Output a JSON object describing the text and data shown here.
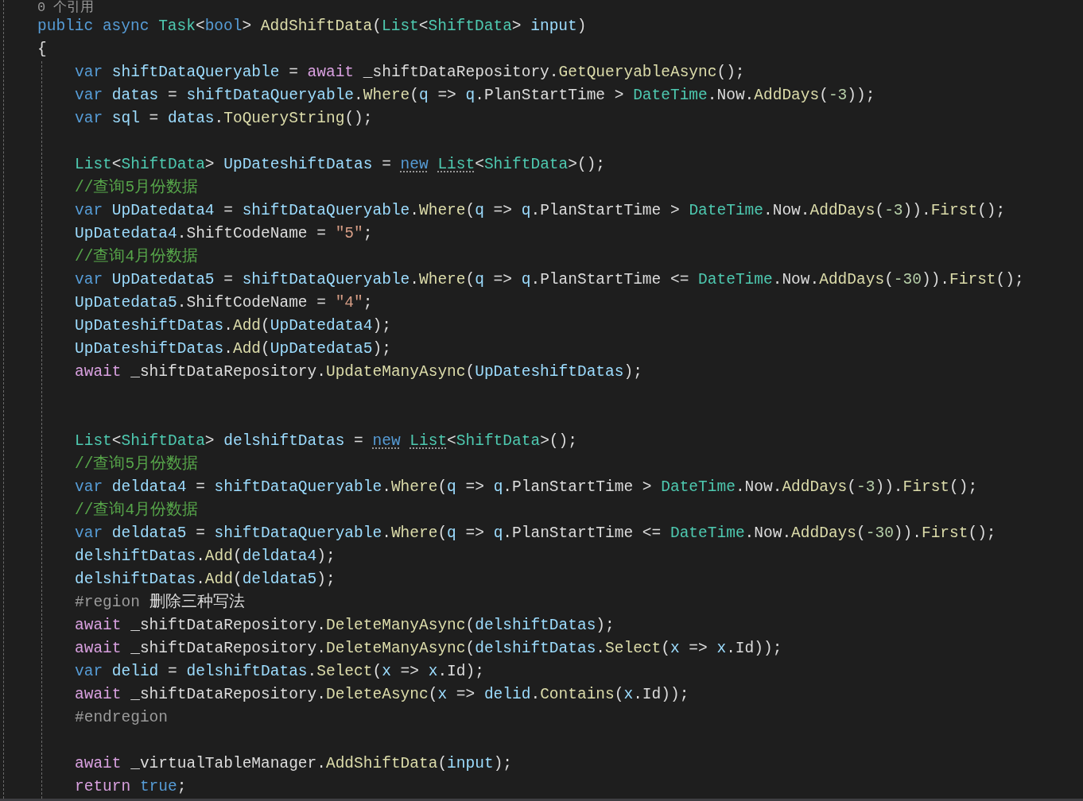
{
  "codelens": "0 个引用",
  "method": {
    "signature": [
      {
        "kind": "k",
        "text": "public async "
      },
      {
        "kind": "t",
        "text": "Task"
      },
      {
        "kind": "p",
        "text": "<"
      },
      {
        "kind": "k",
        "text": "bool"
      },
      {
        "kind": "p",
        "text": "> "
      },
      {
        "kind": "m",
        "text": "AddShiftData"
      },
      {
        "kind": "p",
        "text": "("
      },
      {
        "kind": "t",
        "text": "List"
      },
      {
        "kind": "p",
        "text": "<"
      },
      {
        "kind": "t",
        "text": "ShiftData"
      },
      {
        "kind": "p",
        "text": "> "
      },
      {
        "kind": "v",
        "text": "input"
      },
      {
        "kind": "p",
        "text": ")"
      }
    ],
    "open_brace": "{",
    "body": [
      {
        "kind": "code",
        "tokens": [
          {
            "kind": "k",
            "text": "var "
          },
          {
            "kind": "v",
            "text": "shiftDataQueryable"
          },
          {
            "kind": "p",
            "text": " = "
          },
          {
            "kind": "c",
            "text": "await"
          },
          {
            "kind": "p",
            "text": " _shiftDataRepository."
          },
          {
            "kind": "m",
            "text": "GetQueryableAsync"
          },
          {
            "kind": "p",
            "text": "();"
          }
        ]
      },
      {
        "kind": "code",
        "tokens": [
          {
            "kind": "k",
            "text": "var "
          },
          {
            "kind": "v",
            "text": "datas"
          },
          {
            "kind": "p",
            "text": " = "
          },
          {
            "kind": "v",
            "text": "shiftDataQueryable"
          },
          {
            "kind": "p",
            "text": "."
          },
          {
            "kind": "m",
            "text": "Where"
          },
          {
            "kind": "p",
            "text": "("
          },
          {
            "kind": "v",
            "text": "q"
          },
          {
            "kind": "p",
            "text": " => "
          },
          {
            "kind": "v",
            "text": "q"
          },
          {
            "kind": "p",
            "text": ".PlanStartTime > "
          },
          {
            "kind": "t",
            "text": "DateTime"
          },
          {
            "kind": "p",
            "text": ".Now."
          },
          {
            "kind": "m",
            "text": "AddDays"
          },
          {
            "kind": "p",
            "text": "("
          },
          {
            "kind": "n",
            "text": "-3"
          },
          {
            "kind": "p",
            "text": "));"
          }
        ]
      },
      {
        "kind": "code",
        "tokens": [
          {
            "kind": "k",
            "text": "var "
          },
          {
            "kind": "v",
            "text": "sql"
          },
          {
            "kind": "p",
            "text": " = "
          },
          {
            "kind": "v",
            "text": "datas"
          },
          {
            "kind": "p",
            "text": "."
          },
          {
            "kind": "m",
            "text": "ToQueryString"
          },
          {
            "kind": "p",
            "text": "();"
          }
        ]
      },
      {
        "kind": "blank"
      },
      {
        "kind": "code",
        "tokens": [
          {
            "kind": "t",
            "text": "List"
          },
          {
            "kind": "p",
            "text": "<"
          },
          {
            "kind": "t",
            "text": "ShiftData"
          },
          {
            "kind": "p",
            "text": "> "
          },
          {
            "kind": "v",
            "text": "UpDateshiftDatas"
          },
          {
            "kind": "p",
            "text": " = "
          },
          {
            "kind": "kd",
            "text": "new "
          },
          {
            "kind": "td",
            "text": "List"
          },
          {
            "kind": "p",
            "text": "<"
          },
          {
            "kind": "t",
            "text": "ShiftData"
          },
          {
            "kind": "p",
            "text": ">();"
          }
        ]
      },
      {
        "kind": "code",
        "tokens": [
          {
            "kind": "cm",
            "text": "//查询5月份数据"
          }
        ]
      },
      {
        "kind": "code",
        "tokens": [
          {
            "kind": "k",
            "text": "var "
          },
          {
            "kind": "v",
            "text": "UpDatedata4"
          },
          {
            "kind": "p",
            "text": " = "
          },
          {
            "kind": "v",
            "text": "shiftDataQueryable"
          },
          {
            "kind": "p",
            "text": "."
          },
          {
            "kind": "m",
            "text": "Where"
          },
          {
            "kind": "p",
            "text": "("
          },
          {
            "kind": "v",
            "text": "q"
          },
          {
            "kind": "p",
            "text": " => "
          },
          {
            "kind": "v",
            "text": "q"
          },
          {
            "kind": "p",
            "text": ".PlanStartTime > "
          },
          {
            "kind": "t",
            "text": "DateTime"
          },
          {
            "kind": "p",
            "text": ".Now."
          },
          {
            "kind": "m",
            "text": "AddDays"
          },
          {
            "kind": "p",
            "text": "("
          },
          {
            "kind": "n",
            "text": "-3"
          },
          {
            "kind": "p",
            "text": "))."
          },
          {
            "kind": "m",
            "text": "First"
          },
          {
            "kind": "p",
            "text": "();"
          }
        ]
      },
      {
        "kind": "code",
        "tokens": [
          {
            "kind": "v",
            "text": "UpDatedata4"
          },
          {
            "kind": "p",
            "text": ".ShiftCodeName = "
          },
          {
            "kind": "s",
            "text": "\"5\""
          },
          {
            "kind": "p",
            "text": ";"
          }
        ]
      },
      {
        "kind": "code",
        "tokens": [
          {
            "kind": "cm",
            "text": "//查询4月份数据"
          }
        ]
      },
      {
        "kind": "code",
        "tokens": [
          {
            "kind": "k",
            "text": "var "
          },
          {
            "kind": "v",
            "text": "UpDatedata5"
          },
          {
            "kind": "p",
            "text": " = "
          },
          {
            "kind": "v",
            "text": "shiftDataQueryable"
          },
          {
            "kind": "p",
            "text": "."
          },
          {
            "kind": "m",
            "text": "Where"
          },
          {
            "kind": "p",
            "text": "("
          },
          {
            "kind": "v",
            "text": "q"
          },
          {
            "kind": "p",
            "text": " => "
          },
          {
            "kind": "v",
            "text": "q"
          },
          {
            "kind": "p",
            "text": ".PlanStartTime <= "
          },
          {
            "kind": "t",
            "text": "DateTime"
          },
          {
            "kind": "p",
            "text": ".Now."
          },
          {
            "kind": "m",
            "text": "AddDays"
          },
          {
            "kind": "p",
            "text": "("
          },
          {
            "kind": "n",
            "text": "-30"
          },
          {
            "kind": "p",
            "text": "))."
          },
          {
            "kind": "m",
            "text": "First"
          },
          {
            "kind": "p",
            "text": "();"
          }
        ]
      },
      {
        "kind": "code",
        "tokens": [
          {
            "kind": "v",
            "text": "UpDatedata5"
          },
          {
            "kind": "p",
            "text": ".ShiftCodeName = "
          },
          {
            "kind": "s",
            "text": "\"4\""
          },
          {
            "kind": "p",
            "text": ";"
          }
        ]
      },
      {
        "kind": "code",
        "tokens": [
          {
            "kind": "v",
            "text": "UpDateshiftDatas"
          },
          {
            "kind": "p",
            "text": "."
          },
          {
            "kind": "m",
            "text": "Add"
          },
          {
            "kind": "p",
            "text": "("
          },
          {
            "kind": "v",
            "text": "UpDatedata4"
          },
          {
            "kind": "p",
            "text": ");"
          }
        ]
      },
      {
        "kind": "code",
        "tokens": [
          {
            "kind": "v",
            "text": "UpDateshiftDatas"
          },
          {
            "kind": "p",
            "text": "."
          },
          {
            "kind": "m",
            "text": "Add"
          },
          {
            "kind": "p",
            "text": "("
          },
          {
            "kind": "v",
            "text": "UpDatedata5"
          },
          {
            "kind": "p",
            "text": ");"
          }
        ]
      },
      {
        "kind": "code",
        "tokens": [
          {
            "kind": "c",
            "text": "await"
          },
          {
            "kind": "p",
            "text": " _shiftDataRepository."
          },
          {
            "kind": "m",
            "text": "UpdateManyAsync"
          },
          {
            "kind": "p",
            "text": "("
          },
          {
            "kind": "v",
            "text": "UpDateshiftDatas"
          },
          {
            "kind": "p",
            "text": ");"
          }
        ]
      },
      {
        "kind": "blank"
      },
      {
        "kind": "blank"
      },
      {
        "kind": "code",
        "tokens": [
          {
            "kind": "t",
            "text": "List"
          },
          {
            "kind": "p",
            "text": "<"
          },
          {
            "kind": "t",
            "text": "ShiftData"
          },
          {
            "kind": "p",
            "text": "> "
          },
          {
            "kind": "v",
            "text": "delshiftDatas"
          },
          {
            "kind": "p",
            "text": " = "
          },
          {
            "kind": "kd",
            "text": "new "
          },
          {
            "kind": "td",
            "text": "List"
          },
          {
            "kind": "p",
            "text": "<"
          },
          {
            "kind": "t",
            "text": "ShiftData"
          },
          {
            "kind": "p",
            "text": ">();"
          }
        ]
      },
      {
        "kind": "code",
        "tokens": [
          {
            "kind": "cm",
            "text": "//查询5月份数据"
          }
        ]
      },
      {
        "kind": "code",
        "tokens": [
          {
            "kind": "k",
            "text": "var "
          },
          {
            "kind": "v",
            "text": "deldata4"
          },
          {
            "kind": "p",
            "text": " = "
          },
          {
            "kind": "v",
            "text": "shiftDataQueryable"
          },
          {
            "kind": "p",
            "text": "."
          },
          {
            "kind": "m",
            "text": "Where"
          },
          {
            "kind": "p",
            "text": "("
          },
          {
            "kind": "v",
            "text": "q"
          },
          {
            "kind": "p",
            "text": " => "
          },
          {
            "kind": "v",
            "text": "q"
          },
          {
            "kind": "p",
            "text": ".PlanStartTime > "
          },
          {
            "kind": "t",
            "text": "DateTime"
          },
          {
            "kind": "p",
            "text": ".Now."
          },
          {
            "kind": "m",
            "text": "AddDays"
          },
          {
            "kind": "p",
            "text": "("
          },
          {
            "kind": "n",
            "text": "-3"
          },
          {
            "kind": "p",
            "text": "))."
          },
          {
            "kind": "m",
            "text": "First"
          },
          {
            "kind": "p",
            "text": "();"
          }
        ]
      },
      {
        "kind": "code",
        "tokens": [
          {
            "kind": "cm",
            "text": "//查询4月份数据"
          }
        ]
      },
      {
        "kind": "code",
        "tokens": [
          {
            "kind": "k",
            "text": "var "
          },
          {
            "kind": "v",
            "text": "deldata5"
          },
          {
            "kind": "p",
            "text": " = "
          },
          {
            "kind": "v",
            "text": "shiftDataQueryable"
          },
          {
            "kind": "p",
            "text": "."
          },
          {
            "kind": "m",
            "text": "Where"
          },
          {
            "kind": "p",
            "text": "("
          },
          {
            "kind": "v",
            "text": "q"
          },
          {
            "kind": "p",
            "text": " => "
          },
          {
            "kind": "v",
            "text": "q"
          },
          {
            "kind": "p",
            "text": ".PlanStartTime <= "
          },
          {
            "kind": "t",
            "text": "DateTime"
          },
          {
            "kind": "p",
            "text": ".Now."
          },
          {
            "kind": "m",
            "text": "AddDays"
          },
          {
            "kind": "p",
            "text": "("
          },
          {
            "kind": "n",
            "text": "-30"
          },
          {
            "kind": "p",
            "text": "))."
          },
          {
            "kind": "m",
            "text": "First"
          },
          {
            "kind": "p",
            "text": "();"
          }
        ]
      },
      {
        "kind": "code",
        "tokens": [
          {
            "kind": "v",
            "text": "delshiftDatas"
          },
          {
            "kind": "p",
            "text": "."
          },
          {
            "kind": "m",
            "text": "Add"
          },
          {
            "kind": "p",
            "text": "("
          },
          {
            "kind": "v",
            "text": "deldata4"
          },
          {
            "kind": "p",
            "text": ");"
          }
        ]
      },
      {
        "kind": "code",
        "tokens": [
          {
            "kind": "v",
            "text": "delshiftDatas"
          },
          {
            "kind": "p",
            "text": "."
          },
          {
            "kind": "m",
            "text": "Add"
          },
          {
            "kind": "p",
            "text": "("
          },
          {
            "kind": "v",
            "text": "deldata5"
          },
          {
            "kind": "p",
            "text": ");"
          }
        ]
      },
      {
        "kind": "code",
        "tokens": [
          {
            "kind": "pp",
            "text": "#region"
          },
          {
            "kind": "p",
            "text": " 删除三种写法"
          }
        ]
      },
      {
        "kind": "code",
        "tokens": [
          {
            "kind": "c",
            "text": "await"
          },
          {
            "kind": "p",
            "text": " _shiftDataRepository."
          },
          {
            "kind": "m",
            "text": "DeleteManyAsync"
          },
          {
            "kind": "p",
            "text": "("
          },
          {
            "kind": "v",
            "text": "delshiftDatas"
          },
          {
            "kind": "p",
            "text": ");"
          }
        ]
      },
      {
        "kind": "code",
        "tokens": [
          {
            "kind": "c",
            "text": "await"
          },
          {
            "kind": "p",
            "text": " _shiftDataRepository."
          },
          {
            "kind": "m",
            "text": "DeleteManyAsync"
          },
          {
            "kind": "p",
            "text": "("
          },
          {
            "kind": "v",
            "text": "delshiftDatas"
          },
          {
            "kind": "p",
            "text": "."
          },
          {
            "kind": "m",
            "text": "Select"
          },
          {
            "kind": "p",
            "text": "("
          },
          {
            "kind": "v",
            "text": "x"
          },
          {
            "kind": "p",
            "text": " => "
          },
          {
            "kind": "v",
            "text": "x"
          },
          {
            "kind": "p",
            "text": ".Id));"
          }
        ]
      },
      {
        "kind": "code",
        "tokens": [
          {
            "kind": "k",
            "text": "var "
          },
          {
            "kind": "v",
            "text": "delid"
          },
          {
            "kind": "p",
            "text": " = "
          },
          {
            "kind": "v",
            "text": "delshiftDatas"
          },
          {
            "kind": "p",
            "text": "."
          },
          {
            "kind": "m",
            "text": "Select"
          },
          {
            "kind": "p",
            "text": "("
          },
          {
            "kind": "v",
            "text": "x"
          },
          {
            "kind": "p",
            "text": " => "
          },
          {
            "kind": "v",
            "text": "x"
          },
          {
            "kind": "p",
            "text": ".Id);"
          }
        ]
      },
      {
        "kind": "code",
        "tokens": [
          {
            "kind": "c",
            "text": "await"
          },
          {
            "kind": "p",
            "text": " _shiftDataRepository."
          },
          {
            "kind": "m",
            "text": "DeleteAsync"
          },
          {
            "kind": "p",
            "text": "("
          },
          {
            "kind": "v",
            "text": "x"
          },
          {
            "kind": "p",
            "text": " => "
          },
          {
            "kind": "v",
            "text": "delid"
          },
          {
            "kind": "p",
            "text": "."
          },
          {
            "kind": "m",
            "text": "Contains"
          },
          {
            "kind": "p",
            "text": "("
          },
          {
            "kind": "v",
            "text": "x"
          },
          {
            "kind": "p",
            "text": ".Id));"
          }
        ]
      },
      {
        "kind": "code",
        "tokens": [
          {
            "kind": "pp",
            "text": "#endregion"
          }
        ]
      },
      {
        "kind": "blank"
      },
      {
        "kind": "code",
        "tokens": [
          {
            "kind": "c",
            "text": "await"
          },
          {
            "kind": "p",
            "text": " _virtualTableManager."
          },
          {
            "kind": "m",
            "text": "AddShiftData"
          },
          {
            "kind": "p",
            "text": "("
          },
          {
            "kind": "v",
            "text": "input"
          },
          {
            "kind": "p",
            "text": ");"
          }
        ]
      },
      {
        "kind": "code",
        "tokens": [
          {
            "kind": "c",
            "text": "return "
          },
          {
            "kind": "k",
            "text": "true"
          },
          {
            "kind": "p",
            "text": ";"
          }
        ]
      }
    ]
  }
}
